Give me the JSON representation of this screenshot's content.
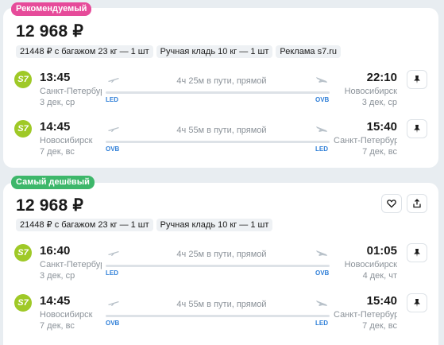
{
  "cards": [
    {
      "badge": "Рекомендуемый",
      "price": "12 968 ₽",
      "tags": [
        "21448 ₽ с багажом 23 кг — 1 шт",
        "Ручная кладь 10 кг — 1 шт",
        "Реклама s7.ru"
      ],
      "segments": [
        {
          "airline_logo": "S7",
          "dep_time": "13:45",
          "dep_city": "Санкт-Петербург",
          "dep_date": "3 дек, ср",
          "duration": "4ч 25м в пути, прямой",
          "from_code": "LED",
          "to_code": "OVB",
          "arr_time": "22:10",
          "arr_city": "Новосибирск",
          "arr_date": "3 дек, ср"
        },
        {
          "airline_logo": "S7",
          "dep_time": "14:45",
          "dep_city": "Новосибирск",
          "dep_date": "7 дек, вс",
          "duration": "4ч 55м в пути, прямой",
          "from_code": "OVB",
          "to_code": "LED",
          "arr_time": "15:40",
          "arr_city": "Санкт-Петербург",
          "arr_date": "7 дек, вс"
        }
      ]
    },
    {
      "badge": "Самый дешёвый",
      "price": "12 968 ₽",
      "tags": [
        "21448 ₽ с багажом 23 кг — 1 шт",
        "Ручная кладь 10 кг — 1 шт"
      ],
      "segments": [
        {
          "airline_logo": "S7",
          "dep_time": "16:40",
          "dep_city": "Санкт-Петербург",
          "dep_date": "3 дек, ср",
          "duration": "4ч 25м в пути, прямой",
          "from_code": "LED",
          "to_code": "OVB",
          "arr_time": "01:05",
          "arr_city": "Новосибирск",
          "arr_date": "4 дек, чт"
        },
        {
          "airline_logo": "S7",
          "dep_time": "14:45",
          "dep_city": "Новосибирск",
          "dep_date": "7 дек, вс",
          "duration": "4ч 55м в пути, прямой",
          "from_code": "OVB",
          "to_code": "LED",
          "arr_time": "15:40",
          "arr_city": "Санкт-Петербург",
          "arr_date": "7 дек, вс"
        }
      ]
    }
  ],
  "icons": {
    "pin": "pin-icon",
    "favorite": "heart-icon",
    "share": "share-icon",
    "departure": "plane-takeoff-icon",
    "arrival": "plane-landing-icon"
  },
  "colors": {
    "badge_recommended": "#e64b9a",
    "badge_cheapest": "#3db76a",
    "airline_logo": "#9fc927",
    "airport_code": "#2f7fd8"
  }
}
